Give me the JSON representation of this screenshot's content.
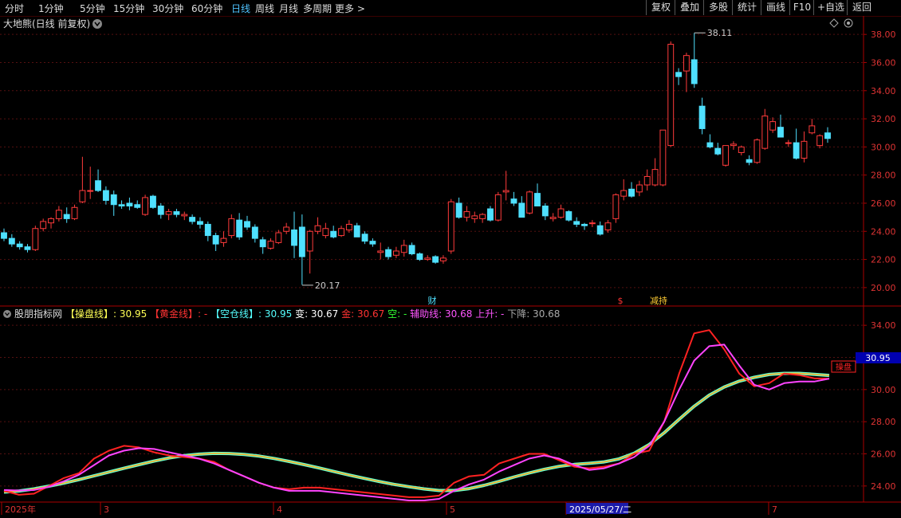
{
  "toolbar": {
    "timeframes": [
      "分时",
      "1分钟",
      "5分钟",
      "15分钟",
      "30分钟",
      "60分钟",
      "日线",
      "周线",
      "月线",
      "多周期",
      "更多 >"
    ],
    "active_timeframe": "日线",
    "right_buttons": [
      "复权",
      "叠加",
      "多股",
      "统计",
      "画线",
      "F10",
      "+自选",
      "返回"
    ]
  },
  "chart_data": [
    {
      "type": "candlestick",
      "title": "大地熊(日线 前复权)",
      "ylim": [
        19.2,
        39.2
      ],
      "yticks": [
        "20.00",
        "22.00",
        "24.00",
        "26.00",
        "28.00",
        "30.00",
        "32.00",
        "34.00",
        "36.00",
        "38.00"
      ],
      "ohlc": [
        [
          23.9,
          24.2,
          23.3,
          23.5
        ],
        [
          23.5,
          23.8,
          22.9,
          23.1
        ],
        [
          23.1,
          23.3,
          22.7,
          22.9
        ],
        [
          22.9,
          23.1,
          22.5,
          22.7
        ],
        [
          22.7,
          24.4,
          22.6,
          24.2
        ],
        [
          24.2,
          24.9,
          24.0,
          24.7
        ],
        [
          24.6,
          25.0,
          24.2,
          24.9
        ],
        [
          24.9,
          25.8,
          24.7,
          25.5
        ],
        [
          25.2,
          25.7,
          24.6,
          24.9
        ],
        [
          24.9,
          25.9,
          24.8,
          25.7
        ],
        [
          26.1,
          29.3,
          26.0,
          26.9
        ],
        [
          26.9,
          28.6,
          26.3,
          26.9
        ],
        [
          27.6,
          28.4,
          26.8,
          26.9
        ],
        [
          26.9,
          27.2,
          25.9,
          26.2
        ],
        [
          26.6,
          26.9,
          25.1,
          25.9
        ],
        [
          25.9,
          26.2,
          25.6,
          25.8
        ],
        [
          26.0,
          26.4,
          25.5,
          25.8
        ],
        [
          25.9,
          26.2,
          25.6,
          25.7
        ],
        [
          25.2,
          26.6,
          25.1,
          26.4
        ],
        [
          26.5,
          26.6,
          25.6,
          25.7
        ],
        [
          25.8,
          26.0,
          24.9,
          25.2
        ],
        [
          25.2,
          25.6,
          24.8,
          25.4
        ],
        [
          25.4,
          25.6,
          25.0,
          25.2
        ],
        [
          25.1,
          25.4,
          24.8,
          25.2
        ],
        [
          25.0,
          25.2,
          24.5,
          24.7
        ],
        [
          24.7,
          25.0,
          24.2,
          24.5
        ],
        [
          24.5,
          24.7,
          23.3,
          23.7
        ],
        [
          23.7,
          23.9,
          22.6,
          23.1
        ],
        [
          23.2,
          24.0,
          22.9,
          23.5
        ],
        [
          23.7,
          25.2,
          23.5,
          24.9
        ],
        [
          24.8,
          25.3,
          23.4,
          23.6
        ],
        [
          24.7,
          25.1,
          24.1,
          24.3
        ],
        [
          24.3,
          24.5,
          23.2,
          23.5
        ],
        [
          23.4,
          23.6,
          22.4,
          22.9
        ],
        [
          22.8,
          23.5,
          22.7,
          23.3
        ],
        [
          23.2,
          24.1,
          23.1,
          23.9
        ],
        [
          24.0,
          24.6,
          23.8,
          24.3
        ],
        [
          24.1,
          25.4,
          22.1,
          23.0
        ],
        [
          24.3,
          25.2,
          20.2,
          22.2
        ],
        [
          22.6,
          24.1,
          21.0,
          24.0
        ],
        [
          24.0,
          25.0,
          23.8,
          24.4
        ],
        [
          23.7,
          24.6,
          23.5,
          24.2
        ],
        [
          24.0,
          24.4,
          23.5,
          23.6
        ],
        [
          23.7,
          24.4,
          23.6,
          24.2
        ],
        [
          24.1,
          24.8,
          23.9,
          24.5
        ],
        [
          24.4,
          24.6,
          23.6,
          23.6
        ],
        [
          23.8,
          24.0,
          23.1,
          23.3
        ],
        [
          23.3,
          23.5,
          22.9,
          23.1
        ],
        [
          22.5,
          23.2,
          22.0,
          22.6
        ],
        [
          22.7,
          22.9,
          22.0,
          22.2
        ],
        [
          22.3,
          22.9,
          22.1,
          22.6
        ],
        [
          22.5,
          23.4,
          22.2,
          23.0
        ],
        [
          23.0,
          23.2,
          22.3,
          22.4
        ],
        [
          22.4,
          22.5,
          21.9,
          22.0
        ],
        [
          22.0,
          22.3,
          21.9,
          22.1
        ],
        [
          22.2,
          22.3,
          21.7,
          21.8
        ],
        [
          21.9,
          22.3,
          21.7,
          22.1
        ],
        [
          22.6,
          26.3,
          22.4,
          26.1
        ],
        [
          26.0,
          26.4,
          24.9,
          25.0
        ],
        [
          25.0,
          25.8,
          24.7,
          25.4
        ],
        [
          24.9,
          25.4,
          24.6,
          25.1
        ],
        [
          24.9,
          25.3,
          24.6,
          25.2
        ],
        [
          25.6,
          25.8,
          24.7,
          24.8
        ],
        [
          24.8,
          26.8,
          24.7,
          26.6
        ],
        [
          26.8,
          28.3,
          26.2,
          26.9
        ],
        [
          26.3,
          26.8,
          25.8,
          26.0
        ],
        [
          26.0,
          26.5,
          25.1,
          25.0
        ],
        [
          25.3,
          26.9,
          25.2,
          26.8
        ],
        [
          26.7,
          27.4,
          25.8,
          25.8
        ],
        [
          25.8,
          26.0,
          24.8,
          25.1
        ],
        [
          24.9,
          25.3,
          24.7,
          25.0
        ],
        [
          25.0,
          25.9,
          24.9,
          25.6
        ],
        [
          25.4,
          25.5,
          24.7,
          24.8
        ],
        [
          24.7,
          25.0,
          24.3,
          24.5
        ],
        [
          24.5,
          24.6,
          24.1,
          24.4
        ],
        [
          24.6,
          24.8,
          24.3,
          24.6
        ],
        [
          24.4,
          24.7,
          23.7,
          23.8
        ],
        [
          24.1,
          24.8,
          23.9,
          24.6
        ],
        [
          24.9,
          26.7,
          24.6,
          26.6
        ],
        [
          26.5,
          27.7,
          26.2,
          26.9
        ],
        [
          27.0,
          27.5,
          26.4,
          26.5
        ],
        [
          26.8,
          27.6,
          26.5,
          27.3
        ],
        [
          27.3,
          28.4,
          26.9,
          27.9
        ],
        [
          27.3,
          29.2,
          27.2,
          28.4
        ],
        [
          27.3,
          31.2,
          27.2,
          31.2
        ],
        [
          30.1,
          37.5,
          30.0,
          37.3
        ],
        [
          35.3,
          35.6,
          34.4,
          35.0
        ],
        [
          35.4,
          36.7,
          33.9,
          36.5
        ],
        [
          36.2,
          38.1,
          34.2,
          34.5
        ],
        [
          32.9,
          33.5,
          30.9,
          31.3
        ],
        [
          30.3,
          30.9,
          29.9,
          30.0
        ],
        [
          29.9,
          30.3,
          29.4,
          29.5
        ],
        [
          28.7,
          30.1,
          28.6,
          30.1
        ],
        [
          30.1,
          30.4,
          29.8,
          30.2
        ],
        [
          29.6,
          30.1,
          29.4,
          30.0
        ],
        [
          29.1,
          29.4,
          28.7,
          28.9
        ],
        [
          28.9,
          30.6,
          28.8,
          30.5
        ],
        [
          29.9,
          32.7,
          29.8,
          32.2
        ],
        [
          31.2,
          32.1,
          31.0,
          31.8
        ],
        [
          31.4,
          32.3,
          30.7,
          30.7
        ],
        [
          30.3,
          30.5,
          30.0,
          30.3
        ],
        [
          30.3,
          31.3,
          29.1,
          29.2
        ],
        [
          29.2,
          31.1,
          28.9,
          30.4
        ],
        [
          31.0,
          32.0,
          30.9,
          31.5
        ],
        [
          30.1,
          30.9,
          29.9,
          30.8
        ],
        [
          31.0,
          31.4,
          30.3,
          30.6
        ]
      ],
      "annotations": [
        {
          "label": "38.11",
          "value": 38.11
        },
        {
          "label": "20.17",
          "value": 20.17
        }
      ],
      "event_markers": [
        "财",
        "$",
        "减持"
      ]
    },
    {
      "type": "line",
      "title": "股朋指标网",
      "ylim": [
        23.0,
        35.0
      ],
      "yticks": [
        "24.00",
        "26.00",
        "28.00",
        "30.00",
        "32.00",
        "34.00"
      ],
      "legend": [
        {
          "text": "【操盘线】: 30.95",
          "color": "#ffff55"
        },
        {
          "text": "【黄金线】: -",
          "color": "#ff3333"
        },
        {
          "text": "【空仓线】: 30.95",
          "color": "#55ffff"
        },
        {
          "text": "变: 30.67",
          "color": "#ffffff"
        },
        {
          "text": "金: 30.67",
          "color": "#ff3333"
        },
        {
          "text": "空: -",
          "color": "#33ff33"
        },
        {
          "text": "辅助线: 30.68",
          "color": "#ff55ff"
        },
        {
          "text": "上升: -",
          "color": "#ff55ff"
        },
        {
          "text": "下降: 30.68",
          "color": "#aaaaaa"
        }
      ],
      "current_value": "30.95",
      "right_marker": "操盘",
      "x_labels": [
        "2025年",
        "3",
        "4",
        "5",
        "2025/05/27/二",
        "7"
      ],
      "series": [
        {
          "name": "操盘线",
          "color": "#66ffcc",
          "values": [
            23.62,
            23.69,
            23.82,
            23.99,
            24.18,
            24.4,
            24.63,
            24.87,
            25.1,
            25.33,
            25.55,
            25.74,
            25.89,
            25.98,
            26.03,
            26.02,
            25.96,
            25.86,
            25.71,
            25.53,
            25.33,
            25.12,
            24.9,
            24.68,
            24.48,
            24.28,
            24.1,
            23.95,
            23.82,
            23.72,
            23.72,
            23.84,
            24.04,
            24.29,
            24.56,
            24.81,
            25.04,
            25.22,
            25.34,
            25.41,
            25.5,
            25.69,
            26.04,
            26.58,
            27.31,
            28.15,
            28.96,
            29.65,
            30.16,
            30.52,
            30.76,
            30.94,
            31.01,
            31.01,
            30.95,
            30.88
          ]
        },
        {
          "name": "黄金线",
          "color": "#ff2222",
          "values": [
            23.7,
            23.45,
            23.52,
            24.0,
            24.5,
            24.8,
            25.7,
            26.2,
            26.5,
            26.4,
            26.1,
            25.9,
            25.8,
            25.7,
            25.5,
            25.0,
            24.6,
            24.2,
            23.9,
            23.8,
            23.9,
            23.9,
            23.8,
            23.7,
            23.6,
            23.5,
            23.4,
            23.3,
            23.3,
            23.4,
            24.2,
            24.6,
            24.7,
            25.4,
            25.7,
            26.0,
            26.0,
            25.6,
            25.2,
            25.1,
            25.2,
            25.4,
            26.0,
            26.2,
            28.0,
            31.0,
            33.5,
            33.7,
            32.5,
            31.0,
            30.2,
            30.4,
            31.0,
            30.9,
            30.7,
            30.67
          ]
        },
        {
          "name": "辅助线",
          "color": "#ff44ff",
          "values": [
            23.75,
            23.72,
            23.75,
            23.95,
            24.3,
            24.7,
            25.3,
            25.9,
            26.2,
            26.35,
            26.3,
            26.1,
            25.9,
            25.7,
            25.4,
            25.0,
            24.6,
            24.2,
            23.9,
            23.7,
            23.7,
            23.7,
            23.6,
            23.5,
            23.4,
            23.3,
            23.2,
            23.1,
            23.1,
            23.2,
            23.7,
            24.1,
            24.4,
            24.9,
            25.3,
            25.7,
            25.9,
            25.7,
            25.3,
            25.0,
            25.1,
            25.4,
            25.8,
            26.5,
            28.0,
            30.0,
            31.8,
            32.7,
            32.8,
            31.5,
            30.3,
            30.0,
            30.4,
            30.5,
            30.5,
            30.68
          ]
        }
      ]
    }
  ]
}
